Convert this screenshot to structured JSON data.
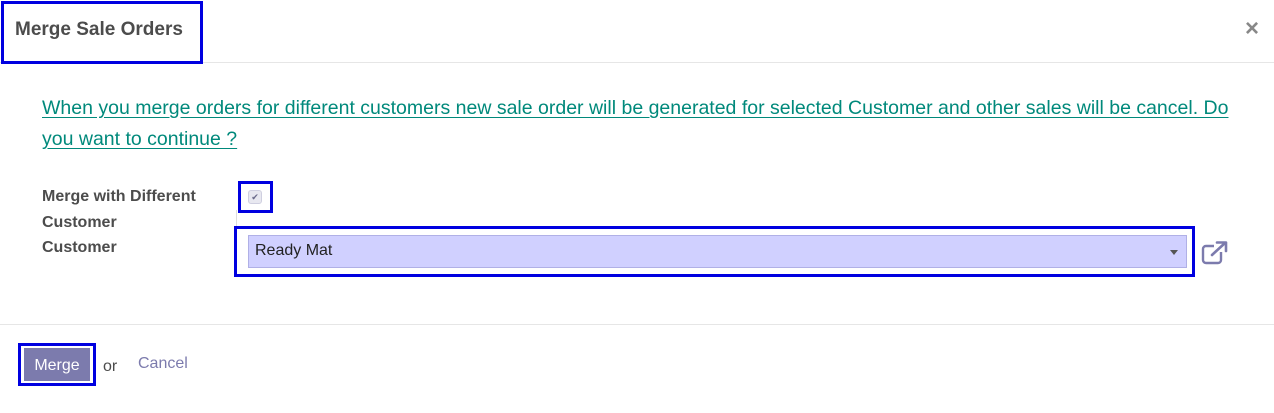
{
  "dialog": {
    "title": "Merge Sale Orders",
    "close_icon": "×"
  },
  "body": {
    "warning": "When you merge orders for different customers new sale order will be generated for selected Customer and other sales will be cancel. Do you want to continue ?",
    "merge_different_label": "Merge with Different Customer",
    "merge_different_checked": true,
    "checkbox_mark": "✔",
    "customer_label": "Customer",
    "customer_value": "Ready Mat"
  },
  "footer": {
    "merge_label": "Merge",
    "or_text": "or",
    "cancel_label": "Cancel"
  },
  "colors": {
    "title_text": "#4c4c4c",
    "warning_link": "#00897b",
    "primary_button": "#7c7bad",
    "select_background": "#d0d0ff",
    "highlight_border": "#0000e0"
  }
}
